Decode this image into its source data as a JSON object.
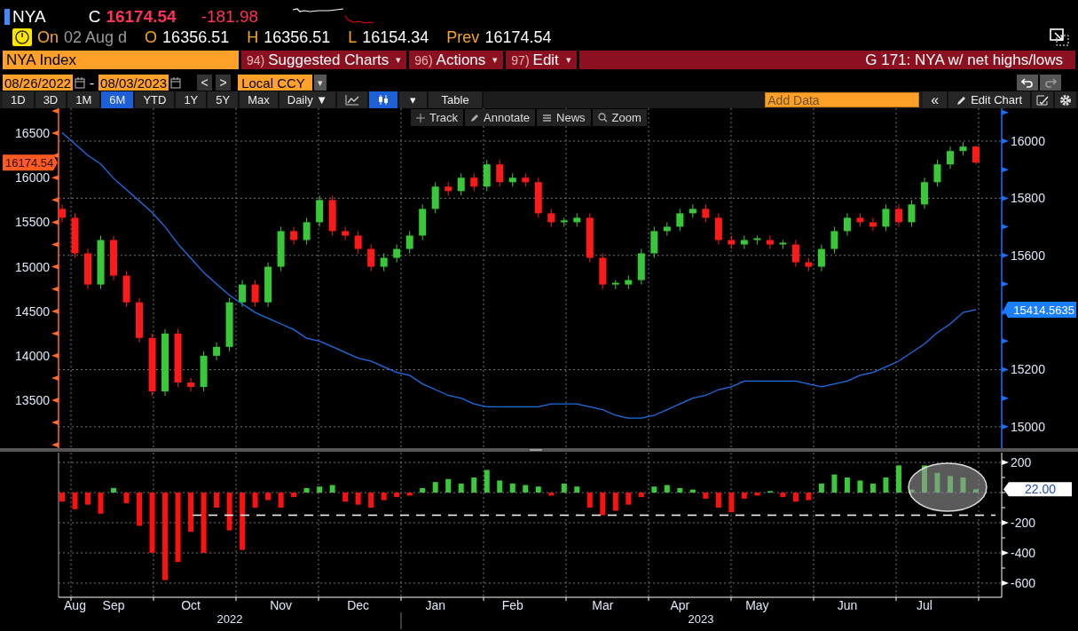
{
  "quote": {
    "ticker": "NYA",
    "close_label": "C",
    "last": "16174.54",
    "change": "-181.98",
    "date_label": "On",
    "date": "02 Aug d",
    "fields": [
      {
        "label": "O",
        "value": "16356.51"
      },
      {
        "label": "H",
        "value": "16356.51"
      },
      {
        "label": "L",
        "value": "16154.34"
      },
      {
        "label": "Prev",
        "value": "16174.54"
      }
    ]
  },
  "command_bar": {
    "security": "NYA Index",
    "menus": [
      {
        "number": "94)",
        "label": "Suggested Charts",
        "caret": "▾"
      },
      {
        "number": "96)",
        "label": "Actions",
        "caret": "▾"
      },
      {
        "number": "97)",
        "label": "Edit",
        "caret": "▾"
      }
    ],
    "title": "G 171: NYA w/ net highs/lows"
  },
  "range_bar": {
    "start_date": "08/26/2022",
    "separator": "-",
    "end_date": "08/03/2023",
    "prev": "<",
    "next": ">",
    "currency": "Local CCY",
    "currency_caret": "▾"
  },
  "toolbar": {
    "periods": [
      {
        "label": "1D",
        "selected": false
      },
      {
        "label": "3D",
        "selected": false
      },
      {
        "label": "1M",
        "selected": false
      },
      {
        "label": "6M",
        "selected": true
      },
      {
        "label": "YTD",
        "selected": false
      },
      {
        "label": "1Y",
        "selected": false
      },
      {
        "label": "5Y",
        "selected": false
      },
      {
        "label": "Max",
        "selected": false
      }
    ],
    "frequency": "Daily ▼",
    "chart_types": [
      {
        "kind": "line",
        "selected": false
      },
      {
        "kind": "candle",
        "selected": true
      }
    ],
    "chart_type_caret": "▾",
    "table": "Table",
    "add_data_placeholder": "Add Data",
    "collapse": "«",
    "edit_chart": "Edit Chart"
  },
  "chart_tools": [
    {
      "kind": "track",
      "label": "Track"
    },
    {
      "kind": "annotate",
      "label": "Annotate"
    },
    {
      "kind": "news",
      "label": "News"
    },
    {
      "kind": "zoom",
      "label": "Zoom"
    }
  ],
  "price_panel": {
    "last_price_tag": "16174.54",
    "chart_data": {
      "type": "candlestick",
      "grid": true,
      "ylim": [
        12962,
        16780
      ],
      "yticks": [
        13500,
        14000,
        14500,
        15000,
        15500,
        16000,
        16500
      ],
      "categories": [
        null,
        null,
        null,
        null,
        null,
        null,
        null,
        null,
        null,
        null,
        null,
        null,
        null,
        null,
        null,
        null,
        null,
        null,
        null,
        null,
        null,
        null,
        null,
        null,
        null,
        null,
        null,
        null,
        null,
        null,
        null,
        null,
        null,
        null,
        null,
        null,
        null,
        null,
        null,
        null,
        null,
        null,
        null,
        null,
        null,
        null,
        null,
        null,
        null,
        null,
        null,
        null,
        null,
        null,
        null,
        null,
        null,
        null,
        null,
        null,
        null,
        null,
        null,
        null,
        null,
        null,
        null,
        null,
        null,
        null,
        null,
        null
      ],
      "ohlc": [
        [
          15650,
          15700,
          15500,
          15550
        ],
        [
          15550,
          15600,
          15100,
          15150
        ],
        [
          15150,
          15200,
          14750,
          14800
        ],
        [
          14800,
          15350,
          14750,
          15300
        ],
        [
          15300,
          15350,
          14850,
          14900
        ],
        [
          14900,
          14950,
          14550,
          14600
        ],
        [
          14600,
          14650,
          14150,
          14200
        ],
        [
          14200,
          14250,
          13550,
          13600
        ],
        [
          13600,
          14300,
          13550,
          14250
        ],
        [
          14250,
          14300,
          13650,
          13700
        ],
        [
          13700,
          13750,
          13600,
          13650
        ],
        [
          13650,
          14050,
          13600,
          14000
        ],
        [
          14000,
          14150,
          13950,
          14100
        ],
        [
          14100,
          14650,
          14050,
          14600
        ],
        [
          14600,
          14850,
          14550,
          14800
        ],
        [
          14800,
          14850,
          14550,
          14600
        ],
        [
          14600,
          15050,
          14550,
          15000
        ],
        [
          15000,
          15450,
          14950,
          15400
        ],
        [
          15400,
          15450,
          15250,
          15300
        ],
        [
          15300,
          15550,
          15250,
          15500
        ],
        [
          15500,
          15800,
          15450,
          15750
        ],
        [
          15750,
          15800,
          15350,
          15400
        ],
        [
          15400,
          15450,
          15300,
          15350
        ],
        [
          15350,
          15400,
          15150,
          15200
        ],
        [
          15200,
          15250,
          14950,
          15000
        ],
        [
          15000,
          15150,
          14950,
          15100
        ],
        [
          15100,
          15250,
          15050,
          15200
        ],
        [
          15200,
          15400,
          15150,
          15350
        ],
        [
          15350,
          15700,
          15300,
          15650
        ],
        [
          15650,
          15950,
          15600,
          15900
        ],
        [
          15900,
          15950,
          15800,
          15850
        ],
        [
          15850,
          16050,
          15800,
          16000
        ],
        [
          16000,
          16050,
          15850,
          15900
        ],
        [
          15900,
          16200,
          15850,
          16150
        ],
        [
          16150,
          16200,
          15900,
          15950
        ],
        [
          15950,
          16050,
          15900,
          16000
        ],
        [
          16000,
          16050,
          15900,
          15950
        ],
        [
          15950,
          16000,
          15550,
          15600
        ],
        [
          15600,
          15650,
          15450,
          15500
        ],
        [
          15500,
          15550,
          15450,
          15520
        ],
        [
          15500,
          15600,
          15450,
          15550
        ],
        [
          15550,
          15600,
          15050,
          15100
        ],
        [
          15100,
          15150,
          14750,
          14800
        ],
        [
          14800,
          14850,
          14750,
          14820
        ],
        [
          14800,
          14900,
          14750,
          14850
        ],
        [
          14850,
          15200,
          14800,
          15150
        ],
        [
          15150,
          15450,
          15100,
          15400
        ],
        [
          15400,
          15500,
          15350,
          15450
        ],
        [
          15450,
          15650,
          15400,
          15600
        ],
        [
          15600,
          15700,
          15550,
          15650
        ],
        [
          15650,
          15700,
          15500,
          15550
        ],
        [
          15550,
          15600,
          15250,
          15300
        ],
        [
          15300,
          15350,
          15200,
          15250
        ],
        [
          15250,
          15350,
          15200,
          15300
        ],
        [
          15300,
          15350,
          15250,
          15320
        ],
        [
          15300,
          15350,
          15200,
          15250
        ],
        [
          15250,
          15300,
          15200,
          15270
        ],
        [
          15250,
          15300,
          15000,
          15050
        ],
        [
          15050,
          15100,
          14950,
          15000
        ],
        [
          15000,
          15250,
          14950,
          15200
        ],
        [
          15200,
          15450,
          15150,
          15400
        ],
        [
          15400,
          15600,
          15350,
          15550
        ],
        [
          15550,
          15600,
          15450,
          15500
        ],
        [
          15500,
          15550,
          15400,
          15450
        ],
        [
          15450,
          15700,
          15400,
          15650
        ],
        [
          15650,
          15700,
          15450,
          15500
        ],
        [
          15500,
          15750,
          15450,
          15700
        ],
        [
          15700,
          16000,
          15650,
          15950
        ],
        [
          15950,
          16200,
          15900,
          16150
        ],
        [
          16150,
          16350,
          16100,
          16300
        ],
        [
          16300,
          16400,
          16250,
          16350
        ],
        [
          16350,
          16360,
          16150,
          16170
        ]
      ]
    }
  },
  "average_overlay": {
    "tag": "15414.5635",
    "chart_data": {
      "type": "line",
      "ylim": [
        14925,
        16115
      ],
      "yticks": [
        15000,
        15200,
        15600,
        15800,
        16000
      ],
      "categories": [
        null,
        null,
        null,
        null,
        null,
        null,
        null,
        null,
        null,
        null,
        null,
        null,
        null,
        null,
        null,
        null,
        null,
        null,
        null,
        null,
        null,
        null,
        null,
        null,
        null,
        null,
        null,
        null,
        null,
        null,
        null,
        null,
        null,
        null,
        null,
        null,
        null,
        null,
        null,
        null,
        null,
        null,
        null,
        null,
        null,
        null,
        null,
        null,
        null,
        null,
        null,
        null,
        null,
        null,
        null,
        null,
        null,
        null,
        null,
        null,
        null,
        null,
        null,
        null,
        null,
        null,
        null,
        null,
        null,
        null,
        null,
        null
      ],
      "series": [
        {
          "color": "#1f6fe8",
          "values": [
            16030,
            15990,
            15950,
            15920,
            15870,
            15830,
            15790,
            15750,
            15700,
            15640,
            15590,
            15540,
            15500,
            15460,
            15430,
            15400,
            15380,
            15360,
            15340,
            15310,
            15300,
            15280,
            15260,
            15240,
            15230,
            15210,
            15190,
            15180,
            15150,
            15130,
            15110,
            15100,
            15080,
            15070,
            15070,
            15070,
            15070,
            15070,
            15080,
            15080,
            15080,
            15070,
            15060,
            15040,
            15030,
            15030,
            15040,
            15060,
            15080,
            15100,
            15110,
            15130,
            15140,
            15160,
            15160,
            15160,
            15160,
            15160,
            15150,
            15140,
            15150,
            15160,
            15180,
            15190,
            15210,
            15230,
            15260,
            15290,
            15330,
            15360,
            15400,
            15410
          ]
        }
      ]
    }
  },
  "breadth_panel": {
    "last_value_tag": "22.00",
    "chart_data": {
      "type": "bar",
      "grid": true,
      "ylim": [
        -694,
        265
      ],
      "yticks": [
        200,
        -200,
        -400,
        -600
      ],
      "categories": [
        null,
        "Aug",
        null,
        null,
        "Sep",
        null,
        null,
        null,
        null,
        null,
        "Oct",
        null,
        null,
        null,
        null,
        null,
        null,
        "Nov",
        null,
        null,
        null,
        null,
        null,
        "Dec",
        null,
        null,
        null,
        null,
        null,
        "Jan",
        null,
        null,
        null,
        null,
        null,
        "Feb",
        null,
        null,
        null,
        null,
        null,
        null,
        "Mar",
        null,
        null,
        null,
        null,
        null,
        "Apr",
        null,
        null,
        null,
        null,
        null,
        "May",
        null,
        null,
        null,
        null,
        null,
        null,
        "Jun",
        null,
        null,
        null,
        null,
        null,
        "Jul",
        null,
        null,
        null,
        null
      ],
      "series": [
        {
          "values": [
            -60,
            -110,
            -80,
            -140,
            30,
            -70,
            -220,
            -400,
            -580,
            -460,
            -260,
            -400,
            -100,
            -250,
            -380,
            -100,
            -50,
            -100,
            -30,
            30,
            40,
            50,
            -60,
            -80,
            -100,
            -50,
            -30,
            -20,
            30,
            70,
            90,
            60,
            100,
            150,
            80,
            60,
            50,
            40,
            -20,
            60,
            40,
            -100,
            -150,
            -120,
            -80,
            -30,
            40,
            50,
            30,
            20,
            -40,
            -100,
            -130,
            -40,
            -20,
            10,
            -30,
            -60,
            -50,
            60,
            120,
            100,
            80,
            60,
            100,
            180,
            20,
            180,
            130,
            110,
            100,
            22
          ]
        }
      ],
      "ref_lines": [
        {
          "axis": "y",
          "value": -150
        }
      ]
    }
  },
  "x_axis": {
    "years": [
      "2022",
      "2023"
    ]
  }
}
